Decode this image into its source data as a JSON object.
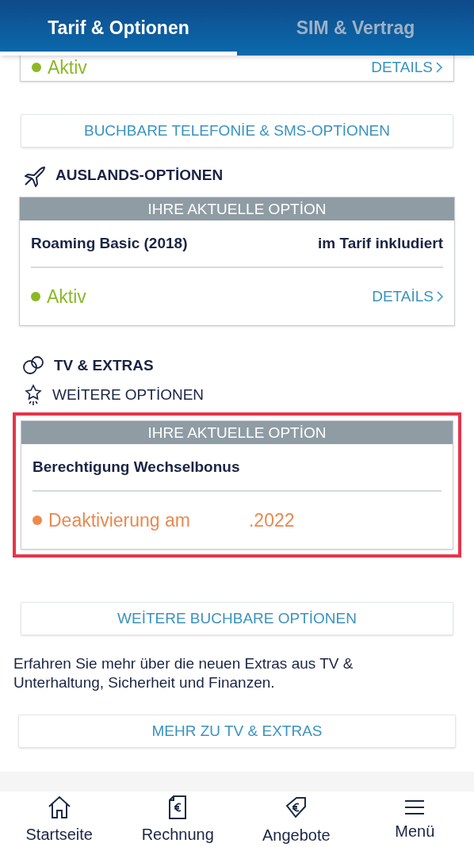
{
  "tabs": [
    {
      "label": "Tarif & Optionen",
      "selected": true
    },
    {
      "label": "SIM & Vertrag",
      "selected": false
    }
  ],
  "top_card": {
    "status": "Aktiv",
    "kind": "active",
    "details": "DETAILS"
  },
  "telephony_button": "BUCHBARE TELEFONİE & SMS-OPTİONEN",
  "abroad": {
    "heading": "AUSLANDS-OPTİONEN",
    "card": {
      "banner": "IHRE AKTUELLE OPTİON",
      "name": "Roaming Basic (2018)",
      "note": "im Tarif inkludiert",
      "status": "Aktiv",
      "kind": "active",
      "details": "DETAİLS"
    }
  },
  "extras": {
    "heading": "TV & EXTRAS",
    "subheading": "WEİTERE OPTİONEN",
    "card": {
      "highlighted": true,
      "banner": "IHRE AKTUELLE OPTİON",
      "name": "Berechtigung Wechselbonus",
      "status": "Deaktivierung am",
      "date": ".2022",
      "kind": "ending"
    }
  },
  "more_options_button": "WEİTERE BUCHBARE OPTİONEN",
  "info_text": "Erfahren Sie mehr über die neuen Extras aus TV & Unterhaltung, Sicherheit und Finanzen.",
  "tv_button": "MEHR ZU TV & EXTRAS",
  "bottom_nav": [
    {
      "label": "Startseite",
      "kind": "home"
    },
    {
      "label": "Rechnung",
      "kind": "invoice"
    },
    {
      "label": "Angebote",
      "kind": "tag"
    },
    {
      "label": "Menü",
      "kind": "menu"
    }
  ]
}
